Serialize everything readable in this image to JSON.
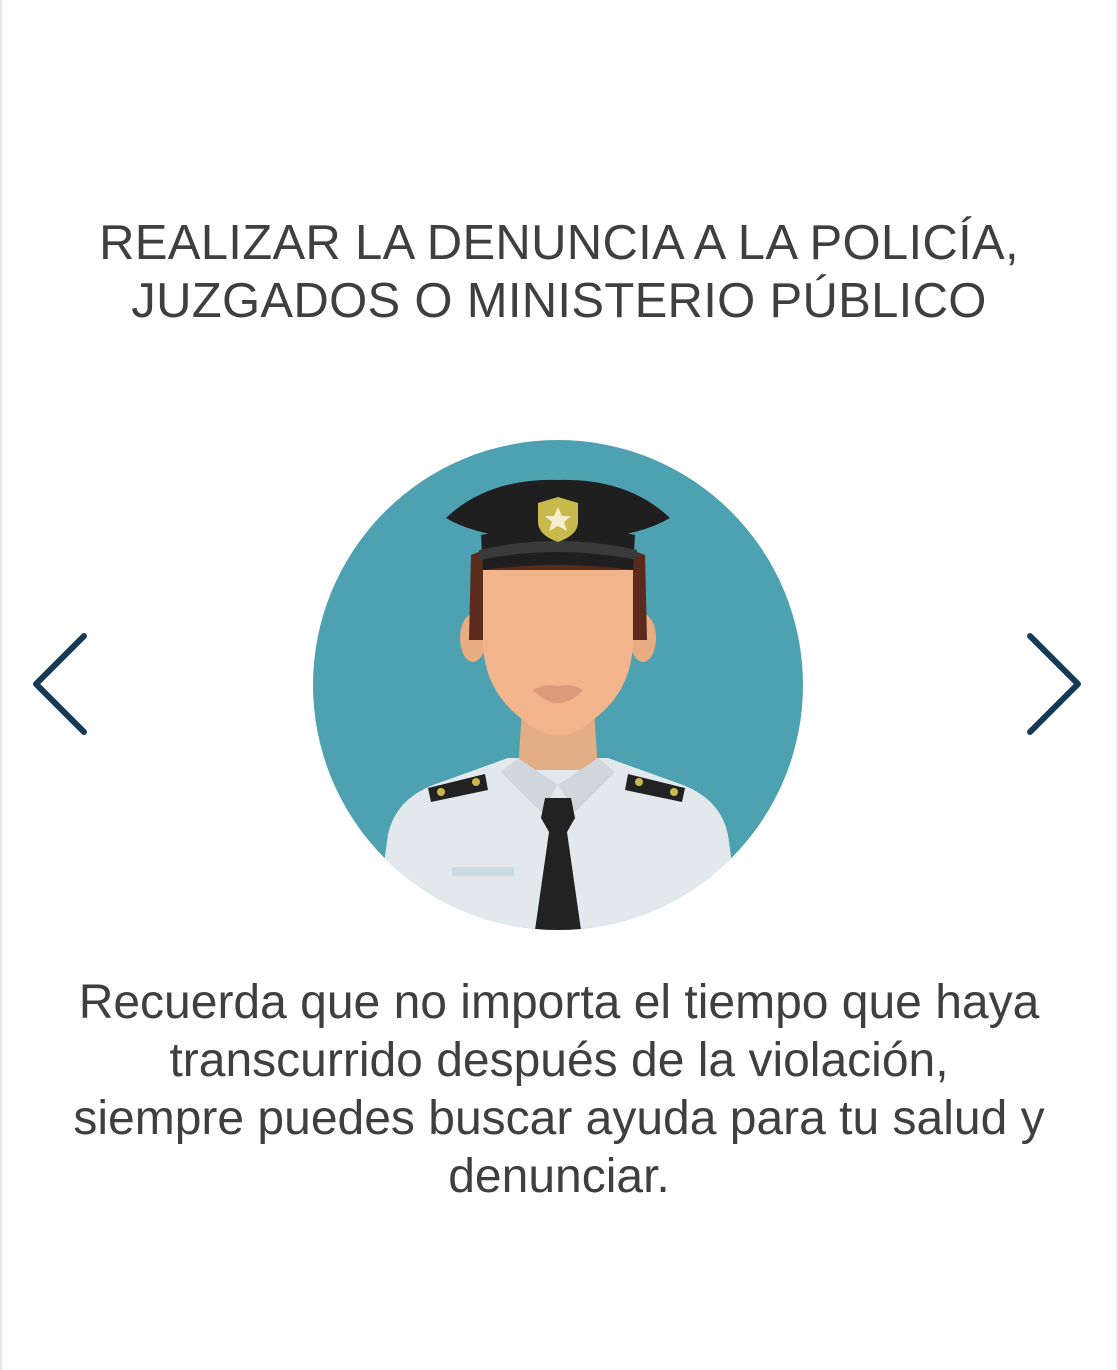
{
  "title": {
    "line1": "REALIZAR LA DENUNCIA A LA POLICÍA,",
    "line2": "JUZGADOS O MINISTERIO PÚBLICO"
  },
  "illustration": {
    "icon": "police-officer-icon",
    "background_color": "#4da1b0"
  },
  "navigation": {
    "prev_icon": "chevron-left-icon",
    "next_icon": "chevron-right-icon",
    "arrow_color": "#163a55"
  },
  "message": {
    "line1": "Recuerda que no importa el tiempo que haya",
    "line2": "transcurrido después de la violación,",
    "line3": "siempre puedes buscar ayuda para tu salud y",
    "line4": "denunciar."
  }
}
